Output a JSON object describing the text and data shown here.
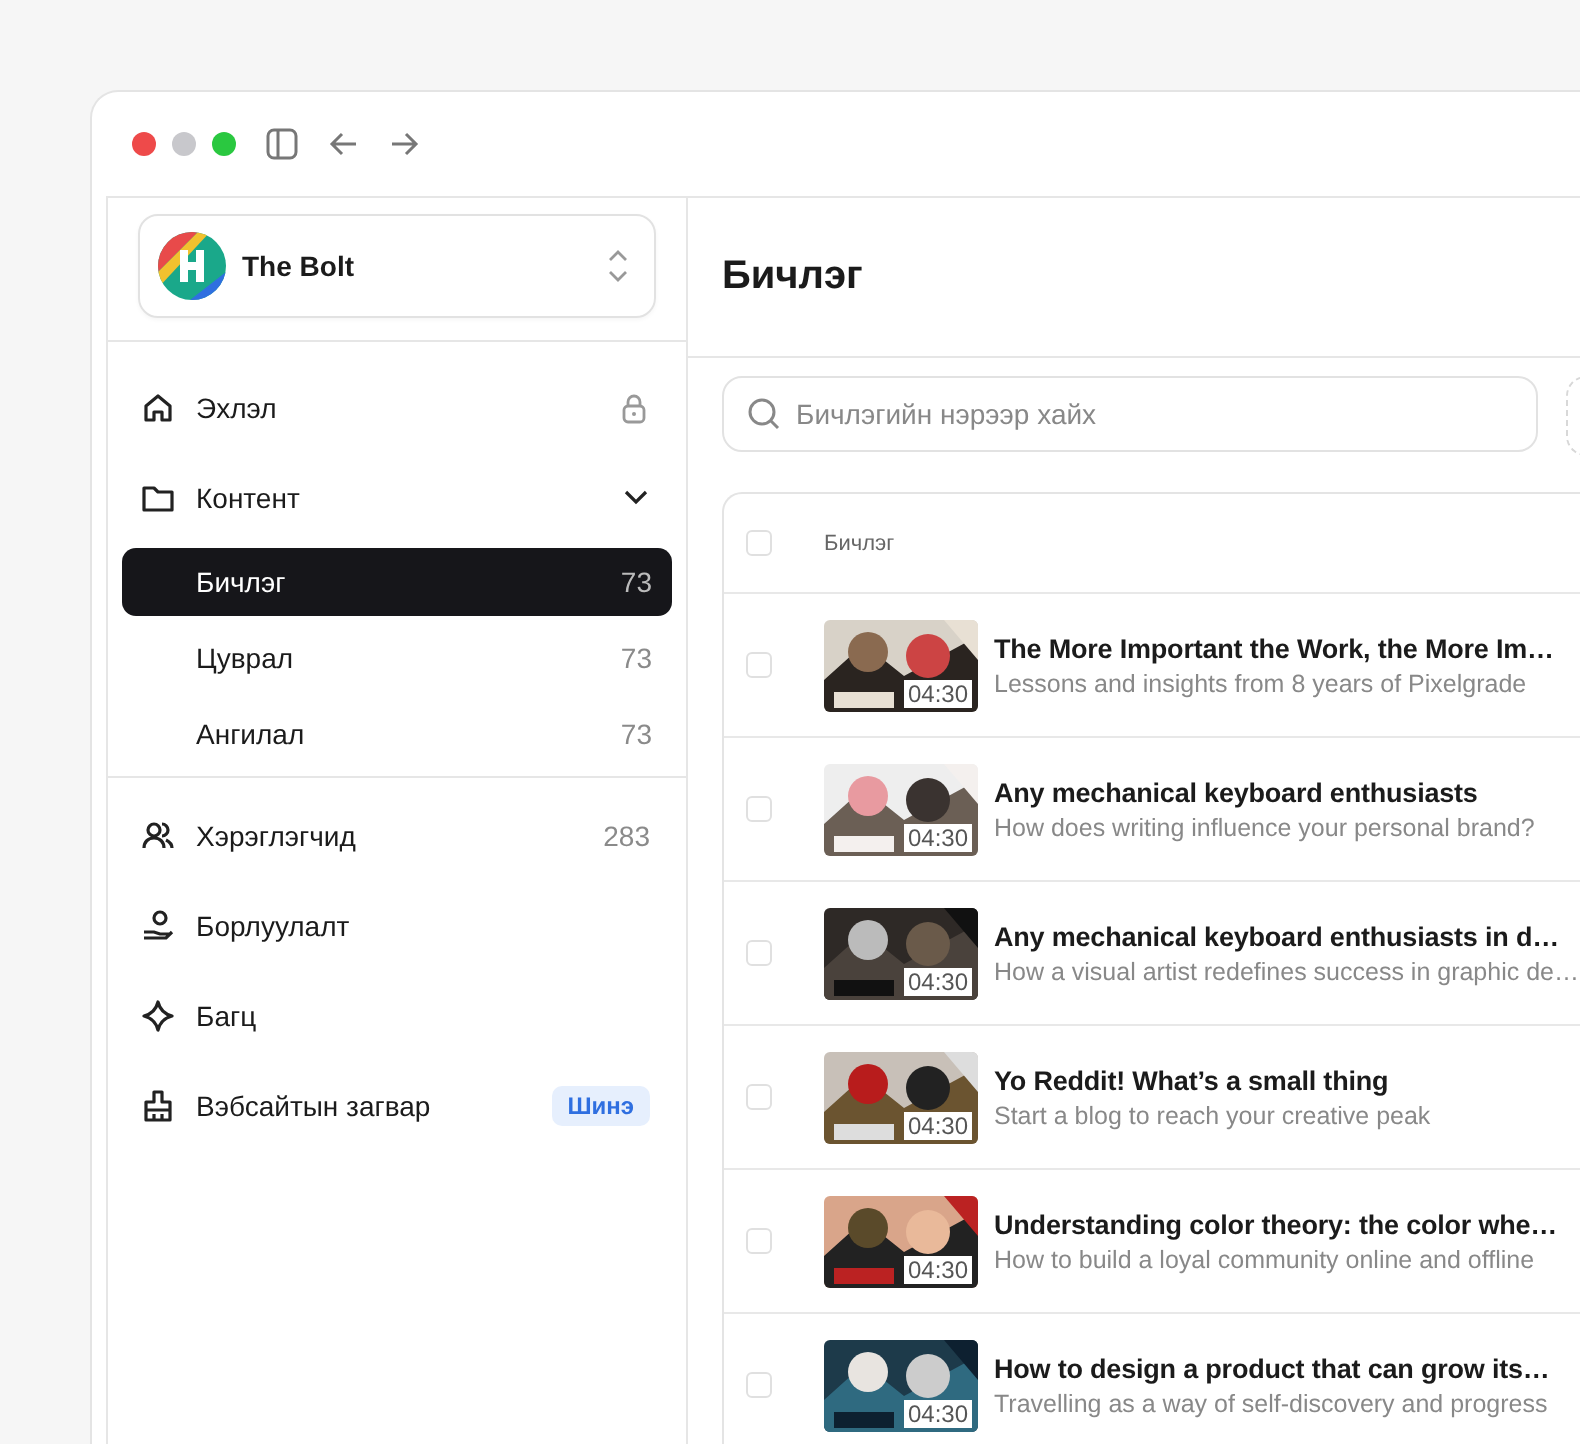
{
  "workspace": {
    "name": "The Bolt"
  },
  "nav": [
    {
      "label": "Эхлэл",
      "locked": true
    },
    {
      "label": "Контент",
      "expanded": true,
      "children": [
        {
          "label": "Бичлэг",
          "count": "73",
          "selected": true
        },
        {
          "label": "Цуврал",
          "count": "73",
          "selected": false
        },
        {
          "label": "Ангилал",
          "count": "73",
          "selected": false
        }
      ]
    },
    {
      "label": "Хэрэглэгчид",
      "count": "283"
    },
    {
      "label": "Борлуулалт"
    },
    {
      "label": "Багц"
    },
    {
      "label": "Вэбсайтын загвар",
      "badge": "Шинэ"
    }
  ],
  "page_title": "Бичлэг",
  "search": {
    "placeholder": "Бичлэгийн нэрээр хайх"
  },
  "table": {
    "columns": [
      "Бичлэг"
    ],
    "header_checked": false,
    "rows": [
      {
        "title": "The More Important the Work, the More Im…",
        "subtitle": "Lessons and insights from 8 years of Pixelgrade",
        "duration": "04:30",
        "checked": false
      },
      {
        "title": "Any mechanical keyboard enthusiasts",
        "subtitle": "How does writing influence your personal brand?",
        "duration": "04:30",
        "checked": false
      },
      {
        "title": "Any mechanical keyboard enthusiasts in d…",
        "subtitle": "How a visual artist redefines success in graphic de…",
        "duration": "04:30",
        "checked": false
      },
      {
        "title": "Yo Reddit! What’s a small thing",
        "subtitle": "Start a blog to reach your creative peak",
        "duration": "04:30",
        "checked": false
      },
      {
        "title": "Understanding color theory: the color whe…",
        "subtitle": "How to build a loyal community online and offline",
        "duration": "04:30",
        "checked": false
      },
      {
        "title": "How to design a product that can grow its…",
        "subtitle": "Travelling as a way of self-discovery and progress",
        "duration": "04:30",
        "checked": false
      }
    ]
  }
}
